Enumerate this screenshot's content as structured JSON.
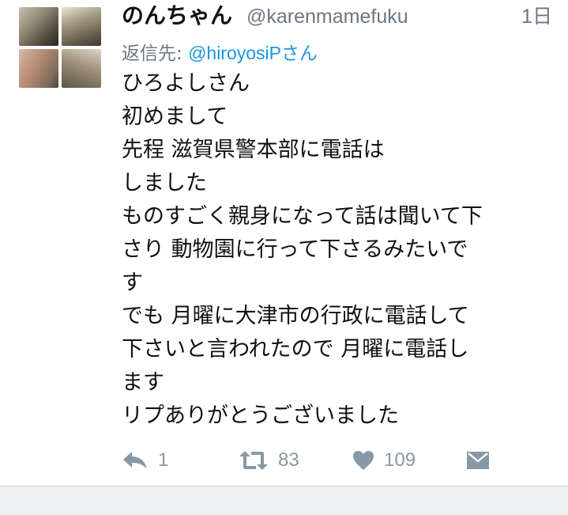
{
  "tweet": {
    "display_name": "のんちゃん",
    "handle": "@karenmamefuku",
    "timestamp": "1日",
    "reply_to": {
      "prefix": "返信先:",
      "user": "@hiroyosiP",
      "suffix": "さん"
    },
    "body_lines": [
      "ひろよしさん",
      "初めまして",
      "先程 滋賀県警本部に電話は",
      "しました",
      "ものすごく親身になって話は聞いて下",
      "さり 動物園に行って下さるみたいで",
      "す",
      "でも 月曜に大津市の行政に電話して",
      "下さいと言われたので 月曜に電話し",
      "ます",
      "リプありがとうございました"
    ],
    "actions": {
      "reply": {
        "icon": "reply-icon",
        "count": "1"
      },
      "retweet": {
        "icon": "retweet-icon",
        "count": "83"
      },
      "like": {
        "icon": "heart-icon",
        "count": "109"
      },
      "dm": {
        "icon": "envelope-icon"
      }
    }
  },
  "colors": {
    "text": "#111111",
    "meta_gray": "#6b7882",
    "link_blue": "#1b95e0",
    "action_gray": "#8899a6",
    "footer_band": "#eef0f2"
  }
}
